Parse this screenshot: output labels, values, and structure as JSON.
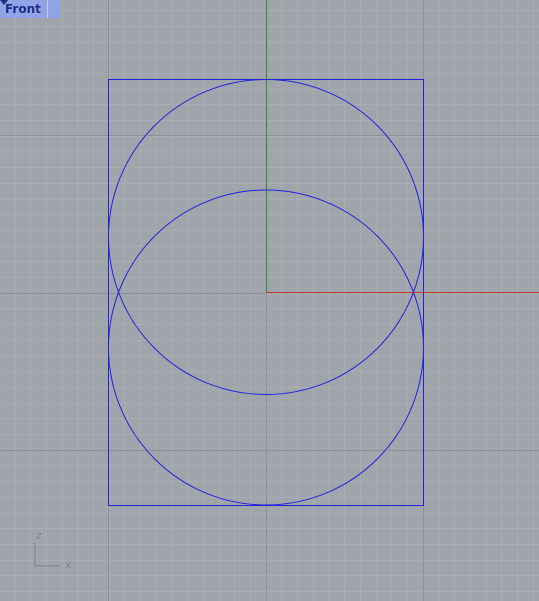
{
  "viewport": {
    "name": "Front",
    "background": "#a0a5ab",
    "grid": true,
    "grid_color": "#b1b5ba",
    "major_grid_color": "#8d9197",
    "axis_x_color": "#c0392b",
    "axis_y_color": "#2e8b2e",
    "curve_color": "#2222dd"
  },
  "axis_indicator": {
    "z_label": "z",
    "x_label": "x"
  }
}
